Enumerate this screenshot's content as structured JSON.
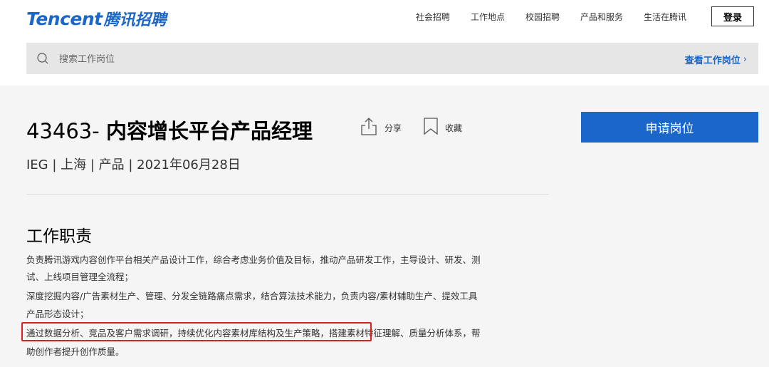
{
  "header": {
    "logo_en": "Tencent",
    "logo_cn": "腾讯招聘",
    "nav": [
      "社会招聘",
      "工作地点",
      "校园招聘",
      "产品和服务",
      "生活在腾讯"
    ],
    "login_label": "登录"
  },
  "search": {
    "placeholder": "搜索工作岗位",
    "view_jobs_label": "查看工作岗位",
    "view_jobs_chevron": "›"
  },
  "job": {
    "title_number": "43463-",
    "title_name": "内容增长平台产品经理",
    "share_label": "分享",
    "favorite_label": "收藏",
    "meta": "IEG | 上海 | 产品 | 2021年06月28日",
    "apply_label": "申请岗位"
  },
  "duties": {
    "title": "工作职责",
    "lines": [
      "负责腾讯游戏内容创作平台相关产品设计工作，综合考虑业务价值及目标，推动产品研发工作，主导设计、研发、测",
      "试、上线项目管理全流程；",
      "深度挖掘内容/广告素材生产、管理、分发全链路痛点需求，结合算法技术能力，负责内容/素材辅助生产、提效工具",
      "产品形态设计；",
      "通过数据分析、竞品及客户需求调研，持续优化内容素材库结构及生产策略，搭建素材特征理解、质量分析体系，帮",
      "助创作者提升创作质量。"
    ]
  },
  "colors": {
    "brand": "#1b66c9",
    "highlight": "#e02020",
    "content_bg": "#f5f5f5"
  }
}
